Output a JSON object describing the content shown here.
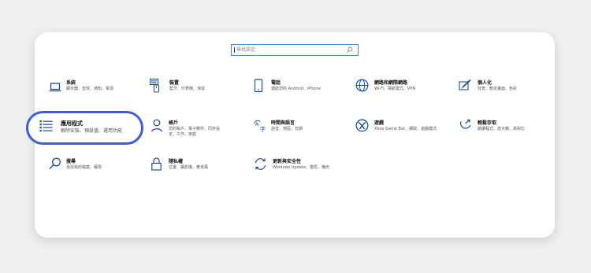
{
  "search": {
    "placeholder": "尋找設定"
  },
  "tiles": [
    {
      "title": "系統",
      "desc": "顯示器、音效、通知、電源",
      "icon": "laptop-icon"
    },
    {
      "title": "裝置",
      "desc": "藍牙、印表機、滑鼠",
      "icon": "keyboard-icon"
    },
    {
      "title": "電話",
      "desc": "連結您的 Android、iPhone",
      "icon": "phone-icon"
    },
    {
      "title": "網路和網際網路",
      "desc": "Wi-Fi、飛航模式、VPN",
      "icon": "globe-icon"
    },
    {
      "title": "個人化",
      "desc": "背景、鎖定畫面、色彩",
      "icon": "pen-icon"
    },
    {
      "title": "應用程式",
      "desc": "解除安裝、預設值、選用功能",
      "icon": "apps-list-icon"
    },
    {
      "title": "帳戶",
      "desc": "您的帳戶、電子郵件、同步設定、工作、家庭",
      "icon": "person-icon"
    },
    {
      "title": "時間與語言",
      "desc": "語音、地區、日期",
      "icon": "time-language-icon"
    },
    {
      "title": "遊戲",
      "desc": "Xbox Game Bar、擷取、遊戲模式",
      "icon": "xbox-icon"
    },
    {
      "title": "輕鬆存取",
      "desc": "朗讀程式、放大鏡、高對比",
      "icon": "ease-of-access-icon"
    },
    {
      "title": "搜尋",
      "desc": "尋找我的檔案、權限",
      "icon": "search-icon"
    },
    {
      "title": "隱私權",
      "desc": "位置、攝影機、麥克風",
      "icon": "lock-icon"
    },
    {
      "title": "更新與安全性",
      "desc": "Windows Update、復原、備份",
      "icon": "refresh-icon"
    }
  ],
  "colors": {
    "accent": "#3b5ee6",
    "icon": "#1a4f9c",
    "search_border": "#4a86d6"
  }
}
